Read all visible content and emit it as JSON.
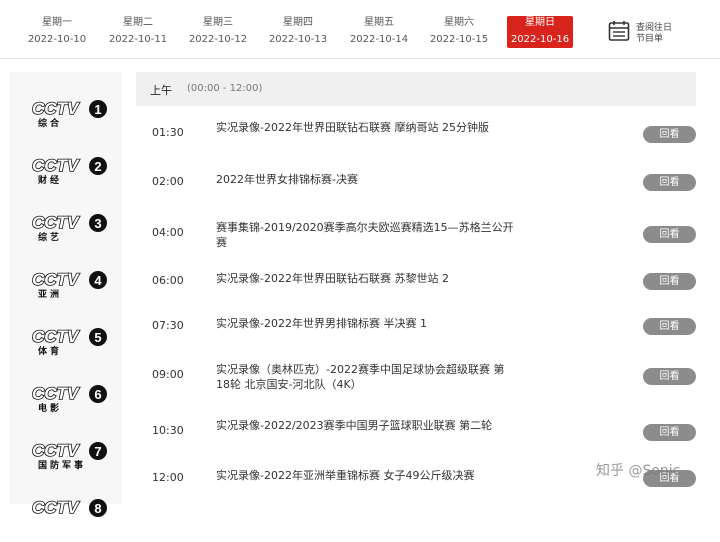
{
  "dates": [
    {
      "weekday": "星期一",
      "date": "2022-10-10",
      "active": false
    },
    {
      "weekday": "星期二",
      "date": "2022-10-11",
      "active": false
    },
    {
      "weekday": "星期三",
      "date": "2022-10-12",
      "active": false
    },
    {
      "weekday": "星期四",
      "date": "2022-10-13",
      "active": false
    },
    {
      "weekday": "星期五",
      "date": "2022-10-14",
      "active": false
    },
    {
      "weekday": "星期六",
      "date": "2022-10-15",
      "active": false
    },
    {
      "weekday": "星期日",
      "date": "2022-10-16",
      "active": true
    }
  ],
  "history": {
    "line1": "查阅往日",
    "line2": "节目单",
    "icon": "calendar-icon"
  },
  "channels": [
    {
      "logo": "CCTV",
      "num": "1",
      "sub": "综合"
    },
    {
      "logo": "CCTV",
      "num": "2",
      "sub": "财经"
    },
    {
      "logo": "CCTV",
      "num": "3",
      "sub": "综艺"
    },
    {
      "logo": "CCTV",
      "num": "4",
      "sub": "亚洲"
    },
    {
      "logo": "CCTV",
      "num": "5",
      "sub": "体育"
    },
    {
      "logo": "CCTV",
      "num": "6",
      "sub": "电影"
    },
    {
      "logo": "CCTV",
      "num": "7",
      "sub": "国防军事"
    },
    {
      "logo": "CCTV",
      "num": "8",
      "sub": ""
    }
  ],
  "period": {
    "name": "上午",
    "range": "(00:00 - 12:00)"
  },
  "programs": [
    {
      "time": "01:30",
      "title": "实况录像-2022年世界田联钻石联赛 摩纳哥站 25分钟版",
      "btn": "回看"
    },
    {
      "time": "02:00",
      "title": "2022年世界女排锦标赛-决赛",
      "btn": "回看"
    },
    {
      "time": "04:00",
      "title": "赛事集锦-2019/2020赛季高尔夫欧巡赛精选15—苏格兰公开赛",
      "btn": "回看"
    },
    {
      "time": "06:00",
      "title": "实况录像-2022年世界田联钻石联赛 苏黎世站 2",
      "btn": "回看"
    },
    {
      "time": "07:30",
      "title": "实况录像-2022年世界男排锦标赛 半决赛 1",
      "btn": "回看"
    },
    {
      "time": "09:00",
      "title": "实况录像（奥林匹克）-2022赛季中国足球协会超级联赛 第18轮 北京国安-河北队（4K）",
      "btn": "回看"
    },
    {
      "time": "10:30",
      "title": "实况录像-2022/2023赛季中国男子篮球职业联赛 第二轮",
      "btn": "回看"
    },
    {
      "time": "12:00",
      "title": "实况录像-2022年亚洲举重锦标赛 女子49公斤级决赛",
      "btn": "回看"
    }
  ],
  "watermark": "知乎 @Sonic",
  "colors": {
    "accent": "#d9231d",
    "button": "#8c8c8c"
  }
}
